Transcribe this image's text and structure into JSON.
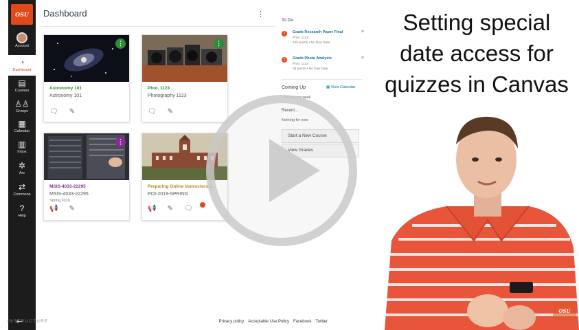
{
  "nav": {
    "logo_text": "OSU",
    "items": [
      {
        "label": "Account",
        "icon": "avatar-icon"
      },
      {
        "label": "Dashboard",
        "icon": "dashboard-icon"
      },
      {
        "label": "Courses",
        "icon": "courses-icon"
      },
      {
        "label": "Groups",
        "icon": "groups-icon"
      },
      {
        "label": "Calendar",
        "icon": "calendar-icon"
      },
      {
        "label": "Inbox",
        "icon": "inbox-icon"
      },
      {
        "label": "Arc",
        "icon": "arc-icon"
      },
      {
        "label": "Commons",
        "icon": "commons-icon"
      },
      {
        "label": "Help",
        "icon": "help-icon"
      }
    ],
    "collapse_icon": "collapse-nav-icon"
  },
  "dashboard": {
    "title": "Dashboard",
    "cards": [
      {
        "title": "Astronomy 101",
        "code": "Astronomy 101",
        "term": "",
        "color": "#2e8b3a",
        "image": "galaxy"
      },
      {
        "title": "Phot. 1123",
        "code": "Photography 1123",
        "term": "",
        "color": "#2e8b3a",
        "image": "cameras"
      },
      {
        "title": "MSIS-4033-22295",
        "code": "MSIS-4033-22295",
        "term": "Spring 2019",
        "color": "#8a2a9a",
        "image": "servers"
      },
      {
        "title": "Preparing Online Instructors 2...",
        "code": "POI-2019-SPRING",
        "term": "",
        "color": "#b5831a",
        "image": "building"
      }
    ]
  },
  "sidebar": {
    "todo_heading": "To Do",
    "todos": [
      {
        "num": "1",
        "title": "Grade Research Paper Final",
        "course": "Phot. 1123",
        "meta": "125 points • No Due Date"
      },
      {
        "num": "2",
        "title": "Grade Photo Analysis",
        "course": "Phot. 1123",
        "meta": "35 points • No Due Date"
      }
    ],
    "coming_up_heading": "Coming Up",
    "view_calendar": "View Calendar",
    "coming_up_text": "...for the next week",
    "recent_heading": "Recent...",
    "recent_text": "Nothing for now",
    "buttons": [
      "Start a New Course",
      "View Grades"
    ]
  },
  "footer": {
    "brand": "INSTRUCTURE",
    "links": [
      "Privacy policy",
      "Acceptable Use Policy",
      "Facebook",
      "Twitter"
    ]
  },
  "video": {
    "title_lines": [
      "Setting special",
      "date access for",
      "quizzes in Canvas"
    ],
    "watermark": "OSU",
    "play_icon": "play-icon"
  },
  "colors": {
    "accent": "#e04a1a",
    "nav_bg": "#1c1c1c",
    "link": "#0770a3"
  }
}
